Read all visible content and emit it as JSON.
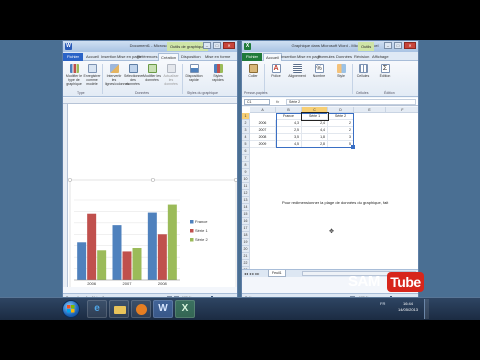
{
  "colors": {
    "france": "#4f81bd",
    "serie1": "#c0504d",
    "serie2": "#9bbb59",
    "ribbon_file_tab": "#2a63c7",
    "excel_selection": "#f7cf74",
    "logo_red": "#d7261c"
  },
  "word": {
    "title": "Document1 - Microsoft Word",
    "context_tab": "Outils de graphique",
    "tabs": [
      "Fichier",
      "Accueil",
      "Insertion",
      "Mise en page",
      "Références",
      "Publipostage",
      "Révision",
      "Affichage",
      "Création",
      "Disposition",
      "Mise en forme"
    ],
    "ribbon": {
      "buttons": [
        "Modifier le type de graphique",
        "Enregistrer comme modèle",
        "Intervertir les lignes/colonnes",
        "Sélectionner des données",
        "Modifier les données",
        "Actualiser les données",
        "Disposition rapide",
        "Styles rapides"
      ],
      "groups": [
        "Type",
        "Données",
        "Dispositions du graphique",
        "Styles du graphique"
      ]
    },
    "status": {
      "page": "Page : 1 sur 1",
      "words": "Mots : 0",
      "zoom": "100 %"
    }
  },
  "chart_data": {
    "type": "bar",
    "categories": [
      "2006",
      "2007",
      "2008"
    ],
    "series": [
      {
        "name": "France",
        "values": [
          3.3,
          4.8,
          5.9
        ]
      },
      {
        "name": "Série 1",
        "values": [
          5.8,
          2.5,
          4.0
        ]
      },
      {
        "name": "Série 2",
        "values": [
          2.6,
          2.8,
          6.6
        ]
      }
    ],
    "title": "",
    "xlabel": "",
    "ylabel": "",
    "ylim": [
      0,
      7
    ],
    "grid": true,
    "legend_position": "right"
  },
  "excel": {
    "title": "Graphique dans Microsoft Word - Microsoft Excel",
    "context_tab": "Outils",
    "tabs": [
      "Fichier",
      "Accueil",
      "Insertion",
      "Mise en page",
      "Formules",
      "Données",
      "Révision",
      "Affichage"
    ],
    "ribbon": {
      "buttons": [
        "Coller",
        "Police",
        "Alignement",
        "Nombre",
        "Style",
        "Cellules",
        "Édition"
      ],
      "groups": [
        "Presse-papiers",
        "Cellules",
        "Édition"
      ]
    },
    "name_box": "C1",
    "formula": "Série 2",
    "columns": [
      "A",
      "B",
      "C",
      "D",
      "E",
      "F"
    ],
    "rows": [
      "1",
      "2",
      "3",
      "4",
      "5",
      "6",
      "7",
      "8",
      "9",
      "10",
      "11",
      "12",
      "13",
      "14",
      "15",
      "16",
      "17",
      "18",
      "19",
      "20",
      "21",
      "22",
      "23"
    ],
    "table": {
      "headers": [
        "France",
        "Série 1",
        "Série 2"
      ],
      "rows": [
        {
          "label": "2006",
          "values": [
            "4,3",
            "2,4",
            "2"
          ]
        },
        {
          "label": "2007",
          "values": [
            "2,5",
            "4,4",
            "2"
          ]
        },
        {
          "label": "2008",
          "values": [
            "3,5",
            "1,8",
            "3"
          ]
        },
        {
          "label": "2009",
          "values": [
            "4,5",
            "2,8",
            "5"
          ]
        }
      ]
    },
    "hint": "Pour redimensionner la plage de données du graphique, fait",
    "sheet_tab": "Feuil1",
    "status": {
      "text": "Prêt",
      "zoom": "100 %"
    }
  },
  "taskbar": {
    "apps": [
      "start",
      "ie",
      "explorer",
      "media-player",
      "word",
      "excel"
    ],
    "word_label": "W",
    "excel_label": "X",
    "tray": "FR",
    "time": "16:44",
    "date": "14/05/2013"
  },
  "logo": {
    "left": "SAM",
    "right": "Tube"
  }
}
